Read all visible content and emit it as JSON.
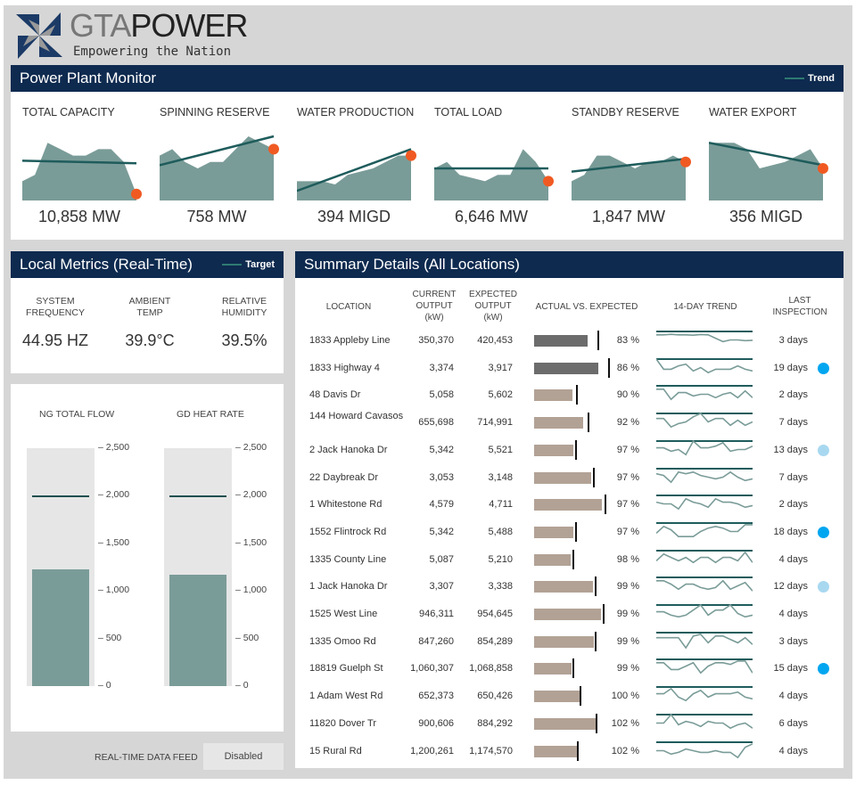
{
  "brand": {
    "name_part1": "GTA",
    "name_part2": "POWER",
    "tagline": "Empowering the Nation"
  },
  "colors": {
    "header": "#0e2a4f",
    "area": "#7a9c98",
    "trend": "#1f5c5c",
    "endpoint": "#f05a22",
    "bar_gray": "#6c6c6c",
    "bar_tan": "#b2a295",
    "dot_strong": "#00a6f0",
    "dot_light": "#a8d8f0"
  },
  "monitor": {
    "title": "Power Plant Monitor",
    "legend": "Trend",
    "kpis": [
      {
        "title": "TOTAL CAPACITY",
        "value": "10,858 MW",
        "series": [
          3,
          4,
          9,
          8,
          7,
          7,
          8,
          8,
          6,
          1
        ],
        "trend": [
          6.2,
          5.8
        ]
      },
      {
        "title": "SPINNING RESERVE",
        "value": "758 MW",
        "series": [
          7,
          8,
          6,
          5,
          6,
          6,
          8,
          10,
          9,
          8
        ],
        "trend": [
          5.5,
          10
        ]
      },
      {
        "title": "WATER PRODUCTION",
        "value": "394 MIGD",
        "series": [
          3,
          3,
          3,
          2.5,
          4,
          4.5,
          5,
          6,
          7,
          7
        ],
        "trend": [
          1.5,
          8
        ]
      },
      {
        "title": "TOTAL LOAD",
        "value": "6,646 MW",
        "series": [
          5,
          6,
          4,
          3.5,
          3,
          4,
          4,
          8,
          6,
          3
        ],
        "trend": [
          5,
          5
        ]
      },
      {
        "title": "STANDBY RESERVE",
        "value": "1,847 MW",
        "series": [
          3,
          4,
          7,
          7,
          6,
          5,
          6,
          6,
          7,
          6
        ],
        "trend": [
          4.5,
          6.5
        ]
      },
      {
        "title": "WATER EXPORT",
        "value": "356 MIGD",
        "series": [
          9,
          9,
          9,
          8,
          5,
          5.5,
          6,
          7,
          8,
          5
        ],
        "trend": [
          9,
          5.5
        ]
      }
    ]
  },
  "local_metrics": {
    "title": "Local Metrics (Real-Time)",
    "legend": "Target",
    "items": [
      {
        "label_line1": "SYSTEM",
        "label_line2": "FREQUENCY",
        "value": "44.95 HZ"
      },
      {
        "label_line1": "AMBIENT",
        "label_line2": "TEMP",
        "value": "39.9°C"
      },
      {
        "label_line1": "RELATIVE",
        "label_line2": "HUMIDITY",
        "value": "39.5%"
      }
    ]
  },
  "gauges": {
    "ticks": [
      "2,500",
      "2,000",
      "1,500",
      "1,000",
      "500",
      "0"
    ],
    "max": 2500,
    "items": [
      {
        "title": "NG TOTAL FLOW",
        "value": 1230,
        "target": 2000
      },
      {
        "title": "GD HEAT RATE",
        "value": 1170,
        "target": 2000
      }
    ]
  },
  "feed": {
    "label": "REAL-TIME DATA FEED",
    "button": "Disabled"
  },
  "summary": {
    "title": "Summary Details (All Locations)",
    "headers": {
      "location": "LOCATION",
      "current": [
        "CURRENT",
        "OUTPUT",
        "(kW)"
      ],
      "expected": [
        "EXPECTED",
        "OUTPUT",
        "(kW)"
      ],
      "actual_vs_expected": "ACTUAL VS. EXPECTED",
      "trend": "14-DAY TREND",
      "inspection": [
        "LAST",
        "INSPECTION"
      ]
    },
    "rows": [
      {
        "location": "1833 Appleby Line",
        "current": "350,370",
        "expected": "420,453",
        "pct": "83 %",
        "bar": 0.6,
        "target": 0.71,
        "style": "gray",
        "inspection": "3 days",
        "dot": "",
        "trend": [
          8,
          8,
          8.3,
          8,
          8,
          7.8,
          8.2,
          8,
          6,
          4,
          5,
          5,
          4.6,
          4.8
        ]
      },
      {
        "location": "1833 Highway 4",
        "current": "3,374",
        "expected": "3,917",
        "pct": "86 %",
        "bar": 0.72,
        "target": 0.83,
        "style": "gray",
        "inspection": "19 days",
        "dot": "strong",
        "trend": [
          10,
          4,
          4,
          6,
          7,
          3,
          5,
          2,
          4,
          4,
          4,
          6,
          4,
          3
        ]
      },
      {
        "location": "48 Davis Dr",
        "current": "5,058",
        "expected": "5,602",
        "pct": "90 %",
        "bar": 0.43,
        "target": 0.47,
        "style": "tan",
        "inspection": "2 days",
        "dot": "",
        "trend": [
          8,
          8,
          2,
          6,
          6,
          4,
          5,
          5,
          3,
          5,
          6,
          3,
          7,
          3
        ]
      },
      {
        "location": "144 Howard Cavasos",
        "current": "655,698",
        "expected": "714,991",
        "pct": "92 %",
        "bar": 0.55,
        "target": 0.6,
        "style": "tan",
        "inspection": "7 days",
        "dot": "",
        "trend": [
          7,
          7,
          2,
          4,
          5,
          8,
          10,
          5,
          7,
          7,
          3,
          6,
          3,
          5
        ]
      },
      {
        "location": "2 Jack Hanoka Dr",
        "current": "5,342",
        "expected": "5,521",
        "pct": "97 %",
        "bar": 0.44,
        "target": 0.46,
        "style": "tan",
        "inspection": "13 days",
        "dot": "light",
        "trend": [
          6,
          6,
          4,
          5,
          2,
          10,
          6,
          6,
          7,
          9,
          4,
          5,
          5,
          7
        ]
      },
      {
        "location": "22 Daybreak Dr",
        "current": "3,053",
        "expected": "3,148",
        "pct": "97 %",
        "bar": 0.64,
        "target": 0.66,
        "style": "tan",
        "inspection": "7 days",
        "dot": "",
        "trend": [
          7,
          6,
          2,
          8,
          7,
          8,
          6,
          5,
          4,
          5,
          8,
          5,
          3,
          4
        ]
      },
      {
        "location": "1 Whitestone Rd",
        "current": "4,579",
        "expected": "4,711",
        "pct": "97 %",
        "bar": 0.76,
        "target": 0.79,
        "style": "tan",
        "inspection": "2 days",
        "dot": "",
        "trend": [
          6,
          5,
          5,
          2,
          8,
          6,
          5,
          3,
          8,
          6,
          6,
          5,
          3,
          4
        ]
      },
      {
        "location": "1552 Flintrock Rd",
        "current": "5,342",
        "expected": "5,488",
        "pct": "97 %",
        "bar": 0.44,
        "target": 0.46,
        "style": "tan",
        "inspection": "18 days",
        "dot": "strong",
        "trend": [
          4,
          8,
          6,
          2,
          2,
          2,
          5,
          7,
          8,
          7,
          5,
          5,
          9,
          9
        ]
      },
      {
        "location": "1335 County Line",
        "current": "5,087",
        "expected": "5,210",
        "pct": "98 %",
        "bar": 0.41,
        "target": 0.43,
        "style": "tan",
        "inspection": "4 days",
        "dot": "",
        "trend": [
          4,
          8,
          6,
          4,
          6,
          3,
          6,
          6,
          3,
          6,
          6,
          4,
          9,
          3
        ]
      },
      {
        "location": "1 Jack Hanoka Dr",
        "current": "3,307",
        "expected": "3,338",
        "pct": "99 %",
        "bar": 0.66,
        "target": 0.68,
        "style": "tan",
        "inspection": "12 days",
        "dot": "light",
        "trend": [
          8,
          8,
          6,
          3,
          6,
          6,
          4,
          3,
          4,
          8,
          3,
          5,
          7,
          2
        ]
      },
      {
        "location": "1525 West Line",
        "current": "946,311",
        "expected": "954,645",
        "pct": "99 %",
        "bar": 0.75,
        "target": 0.77,
        "style": "tan",
        "inspection": "4 days",
        "dot": "",
        "trend": [
          6,
          6,
          4,
          3,
          4,
          7,
          10,
          4,
          7,
          7,
          10,
          5,
          3,
          4
        ]
      },
      {
        "location": "1335 Omoo Rd",
        "current": "847,260",
        "expected": "854,289",
        "pct": "99 %",
        "bar": 0.67,
        "target": 0.68,
        "style": "tan",
        "inspection": "3 days",
        "dot": "",
        "trend": [
          7,
          7,
          7,
          7,
          1,
          8,
          9,
          4,
          8,
          8,
          6,
          4,
          7,
          3
        ]
      },
      {
        "location": "18819 Guelph St",
        "current": "1,060,307",
        "expected": "1,068,858",
        "pct": "99 %",
        "bar": 0.42,
        "target": 0.43,
        "style": "tan",
        "inspection": "15 days",
        "dot": "strong",
        "trend": [
          8,
          8,
          4,
          4,
          6,
          8,
          2,
          6,
          8,
          8,
          7,
          9,
          9,
          2
        ]
      },
      {
        "location": "1 Adam West Rd",
        "current": "652,373",
        "expected": "650,426",
        "pct": "100 %",
        "bar": 0.51,
        "target": 0.51,
        "style": "tan",
        "inspection": "4 days",
        "dot": "",
        "trend": [
          6,
          6,
          9,
          4,
          2,
          6,
          8,
          4,
          6,
          6,
          6,
          7,
          4,
          3
        ]
      },
      {
        "location": "11820 Dover Tr",
        "current": "900,606",
        "expected": "884,292",
        "pct": "102 %",
        "bar": 0.7,
        "target": 0.69,
        "style": "tan",
        "inspection": "6 days",
        "dot": "",
        "trend": [
          5,
          5,
          10,
          4,
          6,
          5,
          3,
          6,
          5,
          5,
          2,
          4,
          5,
          2
        ]
      },
      {
        "location": "15 Rural Rd",
        "current": "1,200,261",
        "expected": "1,174,570",
        "pct": "102 %",
        "bar": 0.49,
        "target": 0.48,
        "style": "tan",
        "inspection": "4 days",
        "dot": "",
        "trend": [
          5,
          5,
          3,
          4,
          6,
          5,
          4,
          4,
          5,
          4,
          4,
          1,
          7,
          9
        ]
      }
    ]
  }
}
